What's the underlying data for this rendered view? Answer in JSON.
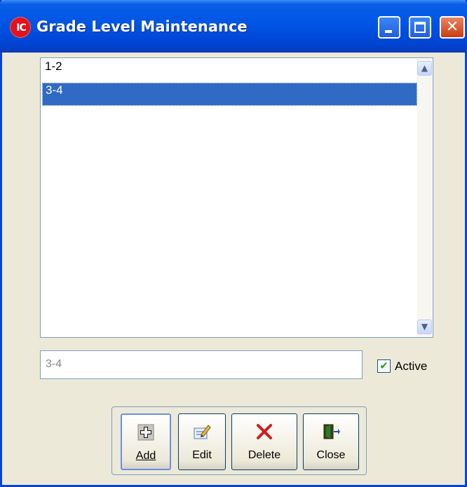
{
  "window": {
    "title": "Grade Level Maintenance",
    "app_icon_text": "IC",
    "controls": {
      "minimize": "_",
      "maximize": "□",
      "close": "✕"
    }
  },
  "list": {
    "items": [
      "1-2",
      "3-4"
    ],
    "selected_index": 1,
    "scroll_up_glyph": "▲",
    "scroll_down_glyph": "▼"
  },
  "editor": {
    "value": "3-4",
    "active_label": "Active",
    "active_checked": true,
    "check_glyph": "✔"
  },
  "toolbar": {
    "add_label": "Add",
    "edit_label": "Edit",
    "delete_label": "Delete",
    "close_label": "Close"
  },
  "colors": {
    "title_bar": "#0055e5",
    "selection": "#316ac5",
    "window_bg": "#ece9d8",
    "close_button": "#cc3b0f",
    "delete_icon": "#d11a1a"
  }
}
